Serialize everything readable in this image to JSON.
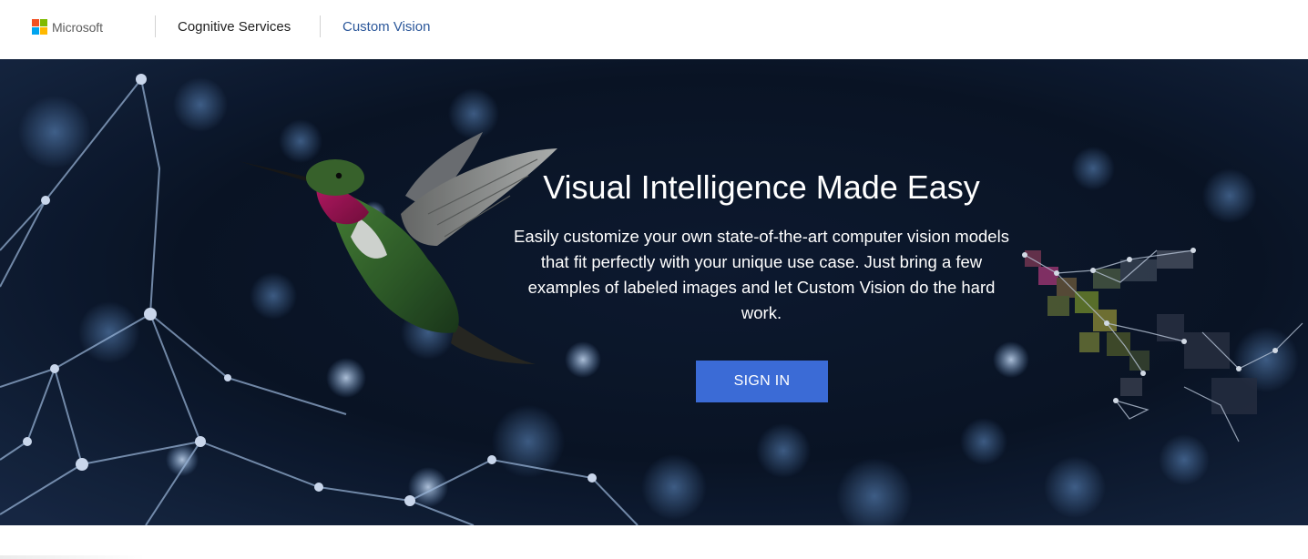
{
  "header": {
    "logo_text": "Microsoft",
    "logo_colors": [
      "#f25022",
      "#7fba00",
      "#00a4ef",
      "#ffb900"
    ],
    "nav": [
      {
        "label": "Cognitive Services"
      },
      {
        "label": "Custom Vision"
      }
    ]
  },
  "hero": {
    "title": "Visual Intelligence Made Easy",
    "description": "Easily customize your own state-of-the-art computer vision models that fit perfectly with your unique use case. Just bring a few examples of labeled images and let Custom Vision do the hard work.",
    "signin_label": "SIGN IN",
    "image": "hummingbird-network-image"
  },
  "colors": {
    "accent": "#2b579a",
    "button": "#3b6bd6",
    "hero_dark": "#0a1528"
  }
}
